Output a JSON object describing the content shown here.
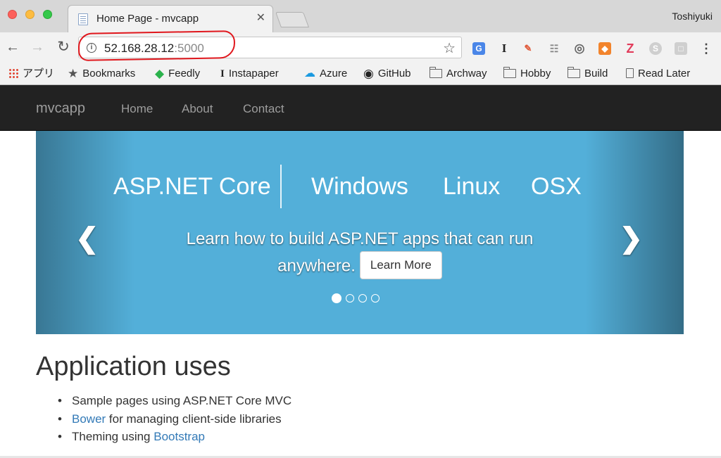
{
  "browser": {
    "tab_title": "Home Page - mvcapp",
    "tab_close": "✕",
    "profile_name": "Toshiyuki",
    "url_host": "52.168.28.12",
    "url_port": ":5000",
    "bookmarks": [
      {
        "label": "アプリ",
        "icon": "apps-grid-icon"
      },
      {
        "label": "Bookmarks",
        "icon": "star-icon"
      },
      {
        "label": "Feedly",
        "icon": "feedly-icon"
      },
      {
        "label": "Instapaper",
        "icon": "instapaper-icon"
      },
      {
        "label": "Azure",
        "icon": "azure-cloud-icon"
      },
      {
        "label": "GitHub",
        "icon": "github-icon"
      },
      {
        "label": "Archway",
        "icon": "folder-icon"
      },
      {
        "label": "Hobby",
        "icon": "folder-icon"
      },
      {
        "label": "Build",
        "icon": "folder-icon"
      },
      {
        "label": "Read Later",
        "icon": "page-icon"
      }
    ],
    "annotation_color": "#e0171d"
  },
  "site": {
    "brand": "mvcapp",
    "nav": [
      "Home",
      "About",
      "Contact"
    ],
    "carousel": {
      "banner_main": "ASP.NET Core",
      "banner_platforms": [
        "Windows",
        "Linux",
        "OSX"
      ],
      "caption": "Learn how to build ASP.NET apps that can run anywhere.",
      "button": "Learn More",
      "active_slide": 1,
      "slide_count": 4,
      "background_color": "#53afd9"
    },
    "section_title": "Application uses",
    "uses": [
      {
        "prefix": "",
        "link": "",
        "suffix": "Sample pages using ASP.NET Core MVC"
      },
      {
        "prefix": "",
        "link": "Bower",
        "suffix": " for managing client-side libraries"
      },
      {
        "prefix": "Theming using ",
        "link": "Bootstrap",
        "suffix": ""
      }
    ],
    "link_color": "#337ab7",
    "navbar_color": "#222222"
  }
}
